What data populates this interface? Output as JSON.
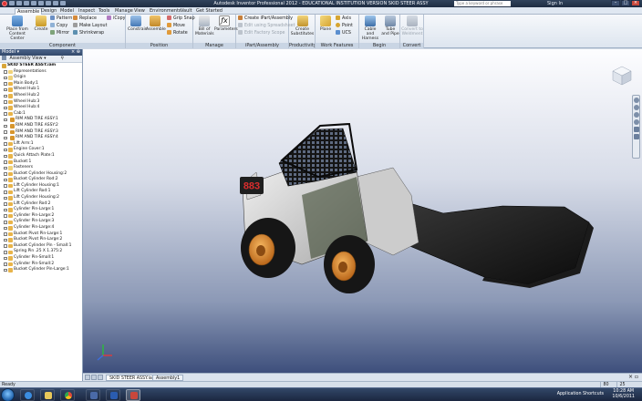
{
  "title_bar": {
    "title": "Autodesk Inventor Professional 2012 - EDUCATIONAL INSTITUTION VERSION    SKID STEER ASSY",
    "search_placeholder": "Type a keyword or phrase",
    "sign_in": "Sign In"
  },
  "ribbon_tabs": [
    "Assemble",
    "Design",
    "Model",
    "Inspect",
    "Tools",
    "Manage",
    "View",
    "Environments",
    "Vault",
    "Get Started"
  ],
  "ribbon": {
    "component": {
      "label": "Component",
      "place": "Place from Content Center",
      "create": "Create",
      "pattern": "Pattern",
      "copy": "Copy",
      "mirror": "Mirror",
      "replace": "Replace",
      "make_layout": "Make Layout",
      "shrinkwrap": "Shrinkwrap",
      "icopy": "iCopy"
    },
    "position": {
      "label": "Position",
      "constrain": "Constrain",
      "assemble": "Assemble",
      "grip_snap": "Grip Snap",
      "move": "Move",
      "rotate": "Rotate"
    },
    "manage": {
      "label": "Manage",
      "bom": "Bill of Materials",
      "parameters": "Parameters"
    },
    "ipart": {
      "label": "iPart/Assembly",
      "create_ipart": "Create iPart/Assembly",
      "edit_spreadsheet": "Edit using Spreadsheet",
      "edit_factory": "Edit Factory Scope"
    },
    "productivity": {
      "label": "Productivity",
      "create_substitutes": "Create Substitutes"
    },
    "work_features": {
      "label": "Work Features",
      "plane": "Plane",
      "axis": "Axis",
      "point": "Point",
      "ucs": "UCS"
    },
    "begin": {
      "label": "Begin",
      "cable": "Cable and Harness",
      "tube": "Tube and Pipe"
    },
    "convert": {
      "label": "Convert",
      "convert_weldment": "Convert to Weldment"
    }
  },
  "browser": {
    "header": "Model",
    "view_label": "Assembly View",
    "nodes": [
      {
        "label": "SKID STEER ASSY.iam",
        "type": "root"
      },
      {
        "label": "Representations",
        "type": "folder"
      },
      {
        "label": "Origin",
        "type": "folder"
      },
      {
        "label": "Main Body:1",
        "type": "part"
      },
      {
        "label": "Wheel Hub:1",
        "type": "part"
      },
      {
        "label": "Wheel Hub:2",
        "type": "part"
      },
      {
        "label": "Wheel Hub:3",
        "type": "part"
      },
      {
        "label": "Wheel Hub:4",
        "type": "part"
      },
      {
        "label": "Cab:1",
        "type": "part"
      },
      {
        "label": "RIM AND TIRE ASSY:1",
        "type": "subassy"
      },
      {
        "label": "RIM AND TIRE ASSY:2",
        "type": "subassy"
      },
      {
        "label": "RIM AND TIRE ASSY:3",
        "type": "subassy"
      },
      {
        "label": "RIM AND TIRE ASSY:4",
        "type": "subassy"
      },
      {
        "label": "Lift Arm:1",
        "type": "part"
      },
      {
        "label": "Engine Cover:1",
        "type": "part"
      },
      {
        "label": "Quick Attach Plate:1",
        "type": "part"
      },
      {
        "label": "Bucket:1",
        "type": "part"
      },
      {
        "label": "Fasteners",
        "type": "folder"
      },
      {
        "label": "Bucket Cylinder Housing:2",
        "type": "part"
      },
      {
        "label": "Bucket Cylinder Rod:2",
        "type": "part"
      },
      {
        "label": "Lift Cylinder Housing:1",
        "type": "part"
      },
      {
        "label": "Lift Cylinder Rod:1",
        "type": "part"
      },
      {
        "label": "Lift Cylinder Housing:2",
        "type": "part"
      },
      {
        "label": "Lift Cylinder Rod:2",
        "type": "part"
      },
      {
        "label": "Cylinder Pin-Large:1",
        "type": "part"
      },
      {
        "label": "Cylinder Pin-Large:2",
        "type": "part"
      },
      {
        "label": "Cylinder Pin-Large:3",
        "type": "part"
      },
      {
        "label": "Cylinder Pin-Large:4",
        "type": "part"
      },
      {
        "label": "Bucket Pivot Pin-Large:1",
        "type": "part"
      },
      {
        "label": "Bucket Pivot Pin-Large:2",
        "type": "part"
      },
      {
        "label": "Bucket Cylinder Pin - Small:1",
        "type": "part"
      },
      {
        "label": "Spring Pin .25 X 1.375:2",
        "type": "part"
      },
      {
        "label": "Cylinder Pin-Small:1",
        "type": "part"
      },
      {
        "label": "Cylinder Pin-Small:2",
        "type": "part"
      },
      {
        "label": "Bucket Cylinder Pin-Large:1",
        "type": "part"
      }
    ]
  },
  "model": {
    "machine_number": "883"
  },
  "doc_tabs": [
    "SKID STEER ASSY.iam",
    "Assembly1"
  ],
  "status": {
    "text": "Ready",
    "count1": "80",
    "count2": "25"
  },
  "taskbar": {
    "app_shortcuts": "Application Shortcuts",
    "time": "10:28 AM",
    "date": "10/6/2011"
  },
  "colors": {
    "accent": "#2b3e5c",
    "viewport_top": "#f8f9fc",
    "viewport_bottom": "#3e4f7c",
    "tire_rim": "#e08a2a",
    "cab": "#1c1c1c"
  }
}
